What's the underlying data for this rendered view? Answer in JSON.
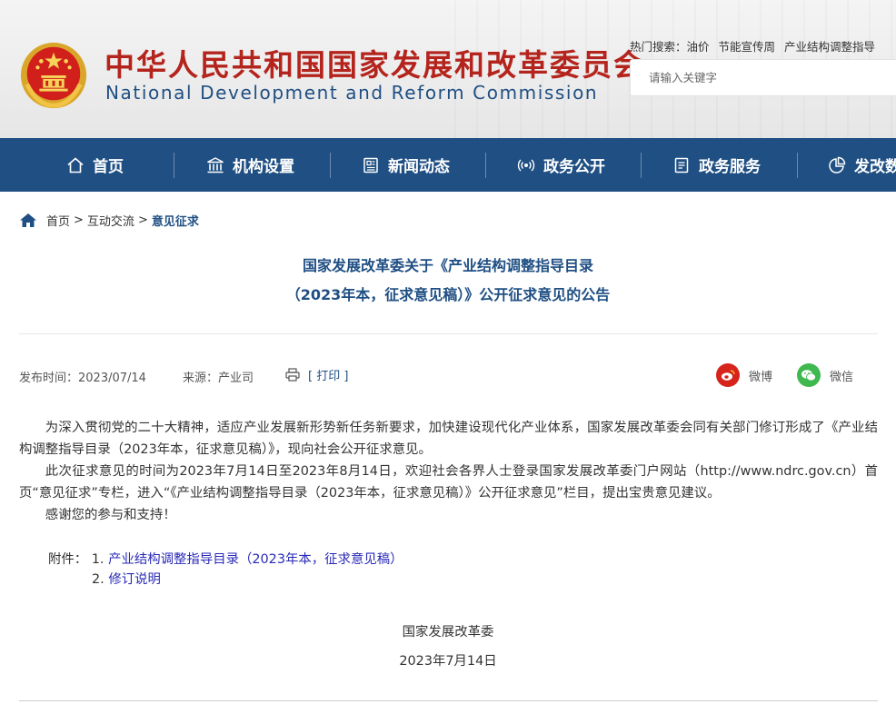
{
  "header": {
    "title_cn": "中华人民共和国国家发展和改革委员会",
    "title_en": "National Development and Reform Commission",
    "hot_search_label": "热门搜索：",
    "hot_search_items": [
      "油价",
      "节能宣传周",
      "产业结构调整指导"
    ],
    "search_placeholder": "请输入关键字"
  },
  "nav": {
    "items": [
      {
        "label": "首页",
        "icon": "home-icon"
      },
      {
        "label": "机构设置",
        "icon": "building-icon"
      },
      {
        "label": "新闻动态",
        "icon": "newspaper-icon"
      },
      {
        "label": "政务公开",
        "icon": "broadcast-icon"
      },
      {
        "label": "政务服务",
        "icon": "document-icon"
      },
      {
        "label": "发改数",
        "icon": "pie-chart-icon"
      }
    ]
  },
  "breadcrumb": {
    "items": [
      "首页",
      "互动交流",
      "意见征求"
    ],
    "separator": ">"
  },
  "article": {
    "title_line1": "国家发展改革委关于《产业结构调整指导目录",
    "title_line2": "（2023年本，征求意见稿）》公开征求意见的公告",
    "publish_time": "发布时间：2023/07/14",
    "source": "来源：产业司",
    "print_label": "[ 打印 ]",
    "share_weibo": "微博",
    "share_wechat": "微信",
    "paragraph1": "为深入贯彻党的二十大精神，适应产业发展新形势新任务新要求，加快建设现代化产业体系，国家发展改革委会同有关部门修订形成了《产业结构调整指导目录（2023年本，征求意见稿）》，现向社会公开征求意见。",
    "paragraph2": "此次征求意见的时间为2023年7月14日至2023年8月14日，欢迎社会各界人士登录国家发展改革委门户网站（http://www.ndrc.gov.cn）首页“意见征求”专栏，进入“《产业结构调整指导目录（2023年本，征求意见稿）》公开征求意见”栏目，提出宝贵意见建议。",
    "paragraph3": "感谢您的参与和支持！",
    "attachments_label": "附件：",
    "attachments": [
      {
        "index": "1.",
        "title": "产业结构调整指导目录（2023年本，征求意见稿）"
      },
      {
        "index": "2.",
        "title": "修订说明"
      }
    ],
    "signature": "国家发展改革委",
    "date": "2023年7月14日"
  },
  "colors": {
    "brand_blue": "#1f4f83",
    "brand_red": "#b4241d",
    "weibo": "#d6231c",
    "wechat": "#3fb84f"
  }
}
